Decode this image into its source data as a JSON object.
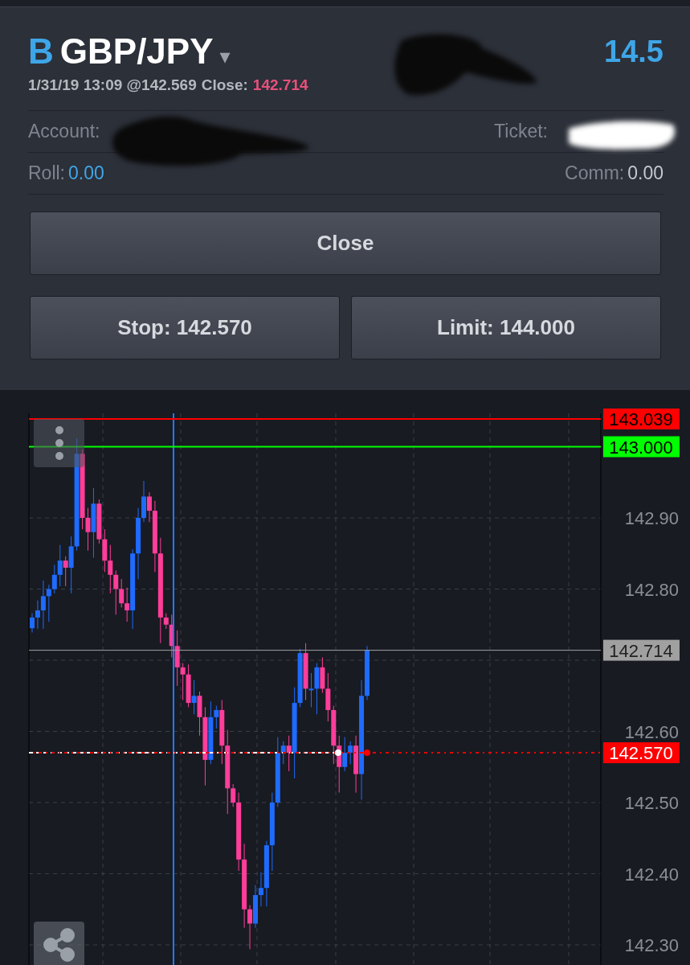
{
  "header": {
    "side": "B",
    "symbol": "GBP/JPY",
    "caret": "▾",
    "profit": "14.5",
    "opened": "1/31/19 13:09 @142.569",
    "close_label": "Close:",
    "close_price": "142.714"
  },
  "details": [
    {
      "label": "Account:"
    },
    {
      "label": "Ticket:"
    }
  ],
  "fees": [
    {
      "label": "Roll:",
      "value": "0.00",
      "kind": "accent"
    },
    {
      "label": "Comm:",
      "value": "0.00",
      "kind": "plain"
    }
  ],
  "close_button": "Close",
  "order_buttons": [
    "Stop: 142.570",
    "Limit: 144.000"
  ],
  "chart": {
    "axis_labels": [
      "142.90",
      "142.80",
      "142.60",
      "142.50",
      "142.40",
      "142.30"
    ],
    "price_tags": [
      {
        "text": "143.039",
        "kind": "solid",
        "color": "#ff0000"
      },
      {
        "text": "143.000",
        "kind": "solid",
        "color": "#00ff00"
      },
      {
        "text": "142.714",
        "kind": "current",
        "color": "#a0a0a0"
      },
      {
        "text": "142.570",
        "kind": "dashed",
        "color": "#ff0000"
      }
    ]
  }
}
